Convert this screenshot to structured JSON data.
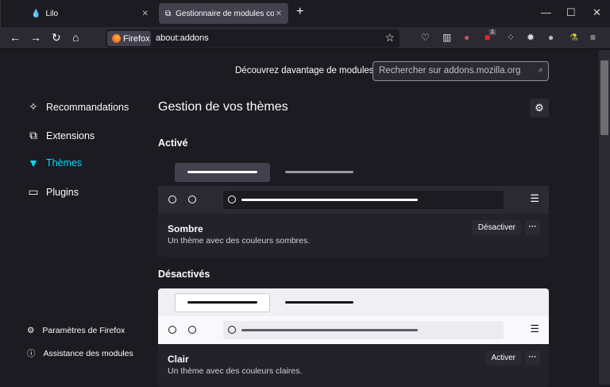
{
  "tabs": [
    {
      "title": "Lilo",
      "icon": "drop-icon"
    },
    {
      "title": "Gestionnaire de modules compl",
      "icon": "puzzle-icon"
    }
  ],
  "toolbar": {
    "identity": "Firefox",
    "url": "about:addons",
    "badge": "1"
  },
  "header": {
    "find_more": "Découvrez davantage de modules",
    "search_placeholder": "Rechercher sur addons.mozilla.org"
  },
  "sidebar": {
    "items": [
      {
        "label": "Recommandations",
        "icon": "sparkles-icon"
      },
      {
        "label": "Extensions",
        "icon": "puzzle-icon"
      },
      {
        "label": "Thèmes",
        "icon": "brush-icon"
      },
      {
        "label": "Plugins",
        "icon": "plugin-icon"
      }
    ],
    "footer": [
      {
        "label": "Paramètres de Firefox"
      },
      {
        "label": "Assistance des modules"
      }
    ]
  },
  "main": {
    "title": "Gestion de vos thèmes",
    "enabled_heading": "Activé",
    "disabled_heading": "Désactivés",
    "themes": [
      {
        "name": "Sombre",
        "description": "Un thème avec des couleurs sombres.",
        "action": "Désactiver"
      },
      {
        "name": "Clair",
        "description": "Un thème avec des couleurs claires.",
        "action": "Activer"
      }
    ],
    "more": "···"
  },
  "colors": {
    "accent": "#00ddff",
    "bg": "#1c1b22",
    "card": "#23222b"
  }
}
